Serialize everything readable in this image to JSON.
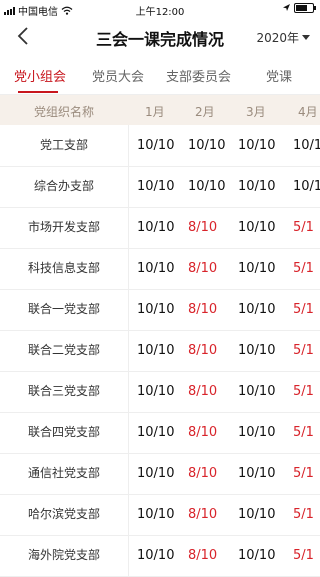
{
  "status_bar": {
    "carrier": "中国电信",
    "time": "上午12:00"
  },
  "nav": {
    "title": "三会一课完成情况",
    "year": "2020年"
  },
  "tabs": [
    {
      "label": "党小组会",
      "active": true
    },
    {
      "label": "党员大会",
      "active": false
    },
    {
      "label": "支部委员会",
      "active": false
    },
    {
      "label": "党课",
      "active": false
    }
  ],
  "colors": {
    "accent": "#c8161d",
    "incomplete": "#d8232a",
    "header_bg": "#f6f0ea"
  },
  "table": {
    "headers": [
      "党组织名称",
      "1月",
      "2月",
      "3月",
      "4月"
    ],
    "rows": [
      {
        "name": "党工支部",
        "values": [
          "10/10",
          "10/10",
          "10/10",
          "10/1"
        ]
      },
      {
        "name": "综合办支部",
        "values": [
          "10/10",
          "10/10",
          "10/10",
          "10/1"
        ]
      },
      {
        "name": "市场开发支部",
        "values": [
          "10/10",
          "8/10",
          "10/10",
          "5/1"
        ]
      },
      {
        "name": "科技信息支部",
        "values": [
          "10/10",
          "8/10",
          "10/10",
          "5/1"
        ]
      },
      {
        "name": "联合一党支部",
        "values": [
          "10/10",
          "8/10",
          "10/10",
          "5/1"
        ]
      },
      {
        "name": "联合二党支部",
        "values": [
          "10/10",
          "8/10",
          "10/10",
          "5/1"
        ]
      },
      {
        "name": "联合三党支部",
        "values": [
          "10/10",
          "8/10",
          "10/10",
          "5/1"
        ]
      },
      {
        "name": "联合四党支部",
        "values": [
          "10/10",
          "8/10",
          "10/10",
          "5/1"
        ]
      },
      {
        "name": "通信社党支部",
        "values": [
          "10/10",
          "8/10",
          "10/10",
          "5/1"
        ]
      },
      {
        "name": "哈尔滨党支部",
        "values": [
          "10/10",
          "8/10",
          "10/10",
          "5/1"
        ]
      },
      {
        "name": "海外院党支部",
        "values": [
          "10/10",
          "8/10",
          "10/10",
          "5/1"
        ]
      }
    ]
  }
}
